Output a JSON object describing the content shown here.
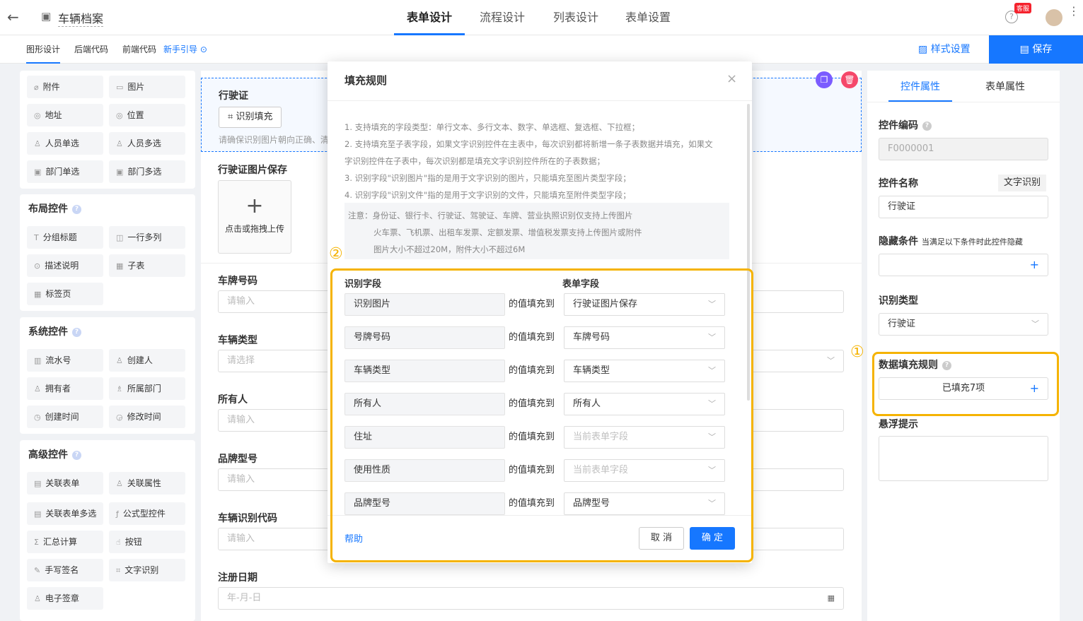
{
  "header": {
    "title": "车辆档案",
    "tabs": [
      "表单设计",
      "流程设计",
      "列表设计",
      "表单设置"
    ],
    "badge": "客服"
  },
  "subnav": {
    "items": [
      "图形设计",
      "后端代码",
      "前端代码"
    ],
    "guide": "新手引导",
    "style_btn": "样式设置",
    "save_btn": "保存"
  },
  "left": {
    "basic": [
      [
        "附件",
        "图片"
      ],
      [
        "地址",
        "位置"
      ],
      [
        "人员单选",
        "人员多选"
      ],
      [
        "部门单选",
        "部门多选"
      ]
    ],
    "layout_title": "布局控件",
    "layout": [
      [
        "分组标题",
        "一行多列"
      ],
      [
        "描述说明",
        "子表"
      ],
      [
        "标签页"
      ]
    ],
    "system_title": "系统控件",
    "system": [
      [
        "流水号",
        "创建人"
      ],
      [
        "拥有者",
        "所属部门"
      ],
      [
        "创建时间",
        "修改时间"
      ]
    ],
    "advanced_title": "高级控件",
    "advanced": [
      [
        "关联表单",
        "关联属性"
      ],
      [
        "关联表单多选",
        "公式型控件"
      ],
      [
        "汇总计算",
        "按钮"
      ],
      [
        "手写签名",
        "文字识别"
      ],
      [
        "电子签章"
      ]
    ]
  },
  "canvas": {
    "ocr_title": "行驶证",
    "ocr_btn": "识别填充",
    "ocr_hint": "请确保识别图片朝向正确、清",
    "img_label": "行驶证图片保存",
    "upload_text": "点击或拖拽上传",
    "fields": [
      {
        "label": "车牌号码",
        "ph": "请输入"
      },
      {
        "label": "车辆类型",
        "ph": "请选择"
      },
      {
        "label": "所有人",
        "ph": "请输入"
      },
      {
        "label": "品牌型号",
        "ph": "请输入"
      },
      {
        "label": "车辆识别代码",
        "ph": "请输入"
      },
      {
        "label": "注册日期",
        "ph": "年-月-日"
      }
    ]
  },
  "right": {
    "tabs": [
      "控件属性",
      "表单属性"
    ],
    "code_label": "控件编码",
    "code_value": "F0000001",
    "name_label": "控件名称",
    "name_tag": "文字识别",
    "name_value": "行驶证",
    "hide_label": "隐藏条件",
    "hide_hint": "当满足以下条件时此控件隐藏",
    "type_label": "识别类型",
    "type_value": "行驶证",
    "fill_label": "数据填充规则",
    "fill_value": "已填充7项",
    "tip_label": "悬浮提示"
  },
  "modal": {
    "title": "填充规则",
    "rules": [
      "1. 支持填充的字段类型：单行文本、多行文本、数字、单选框、复选框、下拉框；",
      "2. 支持填充至子表字段，如果文字识别控件在主表中，每次识别都将新增一条子表数据并填充，如果文",
      "字识别控件在子表中，每次识别都是填充文字识别控件所在的子表数据；",
      "3. 识别字段\"识别图片\"指的是用于文字识别的图片，只能填充至图片类型字段；",
      "4. 识别字段\"识别文件\"指的是用于文字识别的文件，只能填充至附件类型字段；"
    ],
    "notes": [
      "注意：身份证、银行卡、行驶证、驾驶证、车牌、营业执照识别仅支持上传图片",
      "火车票、飞机票、出租车发票、定额发票、增值税发票支持上传图片或附件",
      "图片大小不超过20M，附件大小不超过6M"
    ],
    "col_src": "识别字段",
    "col_dst": "表单字段",
    "fill_to": "的值填充到",
    "mappings": [
      {
        "src": "识别图片",
        "dst": "行驶证图片保存",
        "ph": false
      },
      {
        "src": "号牌号码",
        "dst": "车牌号码",
        "ph": false
      },
      {
        "src": "车辆类型",
        "dst": "车辆类型",
        "ph": false
      },
      {
        "src": "所有人",
        "dst": "所有人",
        "ph": false
      },
      {
        "src": "住址",
        "dst": "当前表单字段",
        "ph": true
      },
      {
        "src": "使用性质",
        "dst": "当前表单字段",
        "ph": true
      },
      {
        "src": "品牌型号",
        "dst": "品牌型号",
        "ph": false
      }
    ],
    "help": "帮助",
    "cancel": "取 消",
    "ok": "确 定"
  },
  "annotations": [
    "①",
    "②"
  ]
}
